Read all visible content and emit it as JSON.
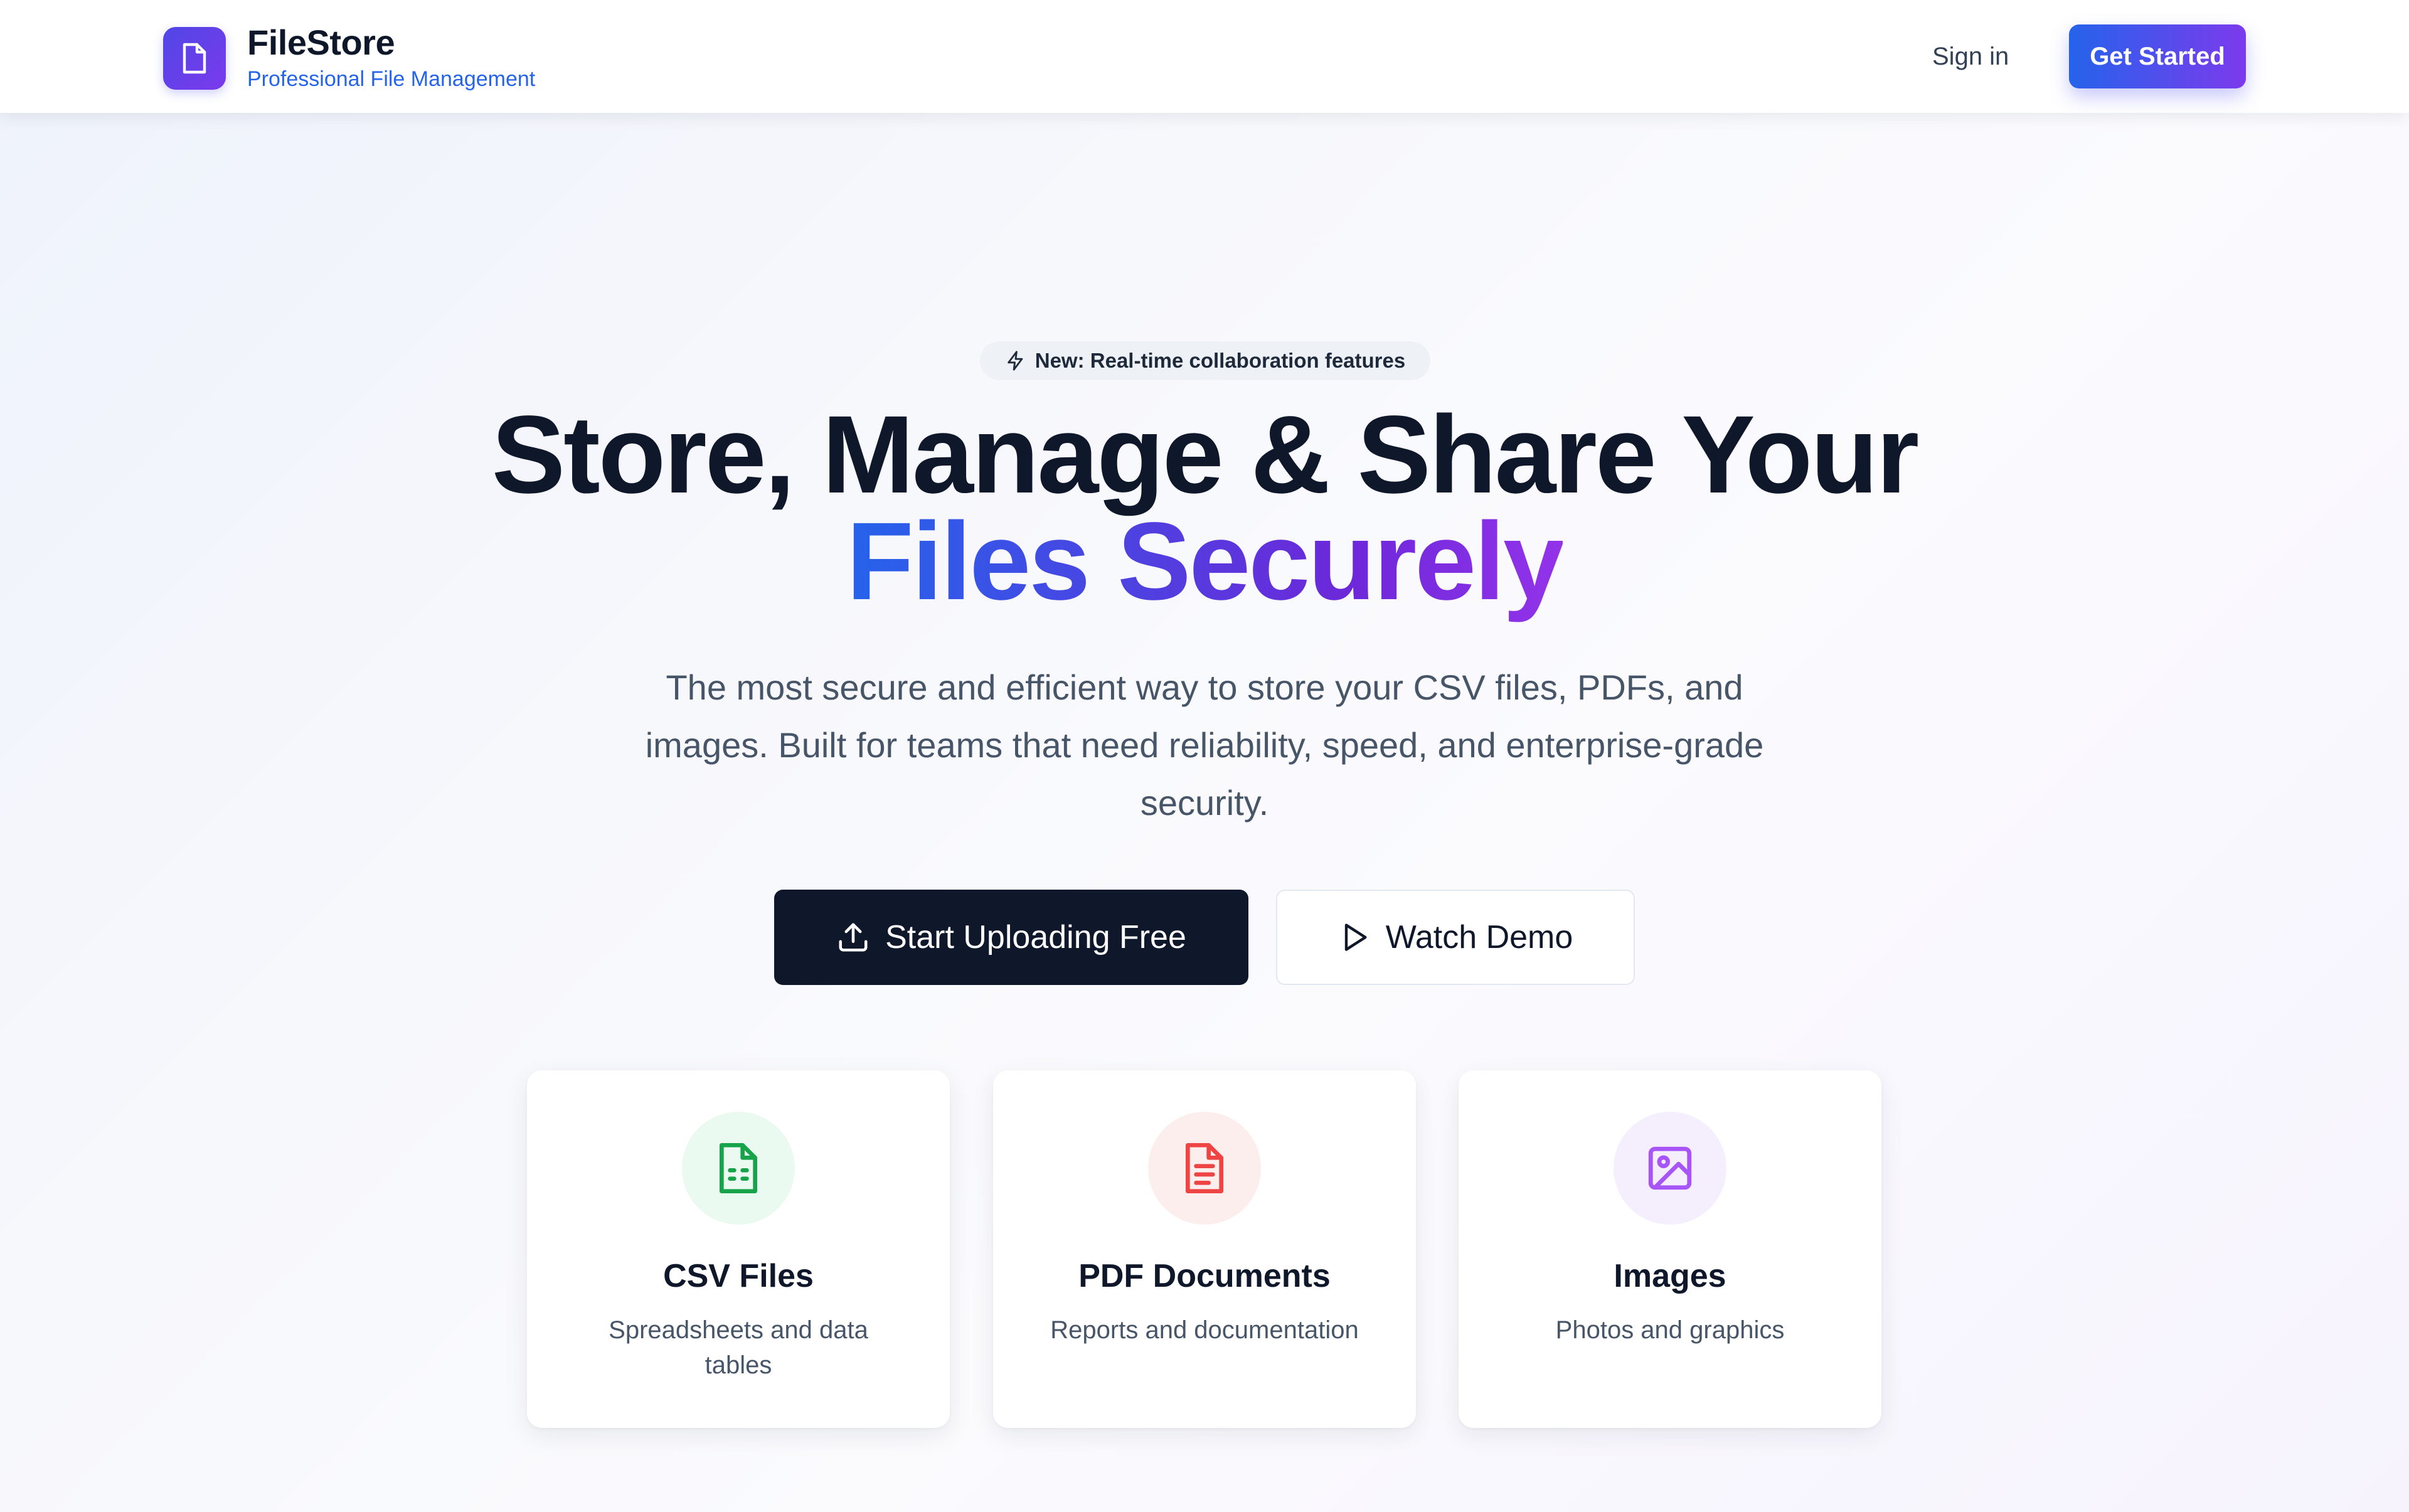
{
  "header": {
    "brand_title": "FileStore",
    "brand_subtitle": "Professional File Management",
    "brand_icon": "file-icon",
    "signin_label": "Sign in",
    "get_started_label": "Get Started"
  },
  "hero": {
    "badge_icon": "lightning-icon",
    "badge_text": "New: Real-time collaboration features",
    "headline_line1": "Store, Manage & Share Your",
    "headline_line2": "Files Securely",
    "subtext": "The most secure and efficient way to store your CSV files, PDFs, and images. Built for teams that need reliability, speed, and enterprise-grade security.",
    "primary_button": {
      "label": "Start Uploading Free",
      "icon": "upload-icon"
    },
    "secondary_button": {
      "label": "Watch Demo",
      "icon": "play-icon"
    }
  },
  "cards": [
    {
      "title": "CSV Files",
      "description": "Spreadsheets and data tables",
      "icon": "spreadsheet-icon",
      "icon_color": "#16a34a",
      "icon_bg": "#eafaf0"
    },
    {
      "title": "PDF Documents",
      "description": "Reports and documentation",
      "icon": "document-icon",
      "icon_color": "#ef4444",
      "icon_bg": "#fdeeee"
    },
    {
      "title": "Images",
      "description": "Photos and graphics",
      "icon": "image-icon",
      "icon_color": "#a855f7",
      "icon_bg": "#f5effd"
    }
  ],
  "colors": {
    "brand_gradient_start": "#2563eb",
    "brand_gradient_end": "#7c3aed",
    "dark": "#0f172a",
    "muted": "#475569"
  }
}
